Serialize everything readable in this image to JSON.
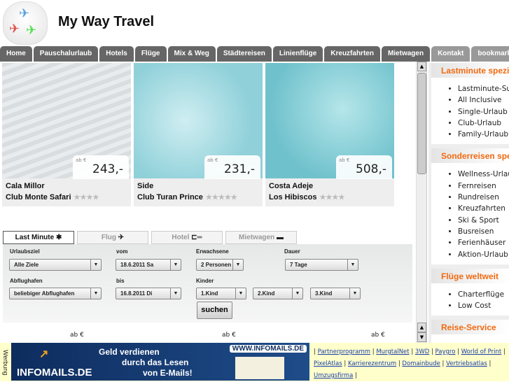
{
  "header": {
    "title": "My Way Travel"
  },
  "nav": {
    "tabs": [
      "Home",
      "Pauschalurlaub",
      "Hotels",
      "Flüge",
      "Mix & Weg",
      "Städtereisen",
      "Linienflüge",
      "Kreuzfahrten",
      "Mietwagen",
      "Kontakt",
      "bookmark"
    ]
  },
  "offers": [
    {
      "price_prefix": "ab €",
      "price": "243,-",
      "place": "Cala Millor",
      "hotel": "Club Monte Safari",
      "stars": "★★★★"
    },
    {
      "price_prefix": "ab €",
      "price": "231,-",
      "place": "Side",
      "hotel": "Club Turan Prince",
      "stars": "★★★★★"
    },
    {
      "price_prefix": "ab €",
      "price": "508,-",
      "place": "Costa Adeje",
      "hotel": "Los Hibiscos",
      "stars": "★★★★"
    }
  ],
  "search": {
    "tabs": [
      "Last Minute",
      "Flug",
      "Hotel",
      "Mietwagen"
    ],
    "labels": {
      "destination": "Urlaubsziel",
      "from": "vom",
      "adults": "Erwachsene",
      "duration": "Dauer",
      "airport": "Abflughafen",
      "to": "bis",
      "children": "Kinder"
    },
    "values": {
      "destination": "Alle Ziele",
      "from": "18.6.2011 Sa",
      "adults": "2 Personen",
      "duration": "7 Tage",
      "airport": "beliebiger Abflughafen",
      "to": "16.8.2011 Di",
      "child1": "1.Kind",
      "child2": "2.Kind",
      "child3": "3.Kind"
    },
    "submit": "suchen"
  },
  "bottom_prices": [
    "ab €",
    "ab €",
    "ab €"
  ],
  "sidebar": [
    {
      "title": "Lastminute spezial",
      "items": [
        "Lastminute-Suche",
        "All Inclusive",
        "Single-Urlaub",
        "Club-Urlaub",
        "Family-Urlaub"
      ]
    },
    {
      "title": "Sonderreisen spezial",
      "items": [
        "Wellness-Urlaub",
        "Fernreisen",
        "Rundreisen",
        "Kreuzfahrten",
        "Ski & Sport",
        "Busreisen",
        "Ferienhäuser",
        "Aktion-Urlaub"
      ]
    },
    {
      "title": "Flüge weltweit",
      "items": [
        "Charterflüge",
        "Low Cost"
      ]
    },
    {
      "title": "Reise-Service",
      "items": []
    }
  ],
  "ad": {
    "label": "Werbung",
    "banner_line1": "Geld verdienen",
    "banner_line2": "durch das Lesen",
    "banner_line3": "von E-Mails!",
    "banner_url": "WWW.INFOMAILS.DE",
    "banner_brand": "INFOMAILS.DE",
    "links": [
      "Partnerprogramm",
      "MurgtalNet",
      "3WD",
      "Paygro",
      "World of Print",
      "PixelAtlas",
      "Karrierezentrum",
      "Domainbude",
      "Vertriebsatlas",
      "Umzugsfirma"
    ]
  },
  "colors": {
    "accent": "#f26a10",
    "nav": "#666666",
    "ad_bg": "#ffffcc"
  }
}
